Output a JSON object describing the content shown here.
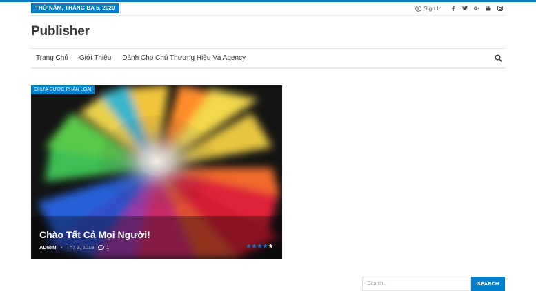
{
  "topbar": {
    "date": "THỨ NĂM, THÁNG BA 5, 2020",
    "signin_label": "Sign In",
    "socials": [
      "facebook-icon",
      "twitter-icon",
      "google-plus-icon",
      "youtube-icon",
      "instagram-icon"
    ],
    "accent": "#0080ce"
  },
  "site": {
    "logo": "Publisher"
  },
  "nav": {
    "items": [
      {
        "label": "Trang Chủ"
      },
      {
        "label": "Giới Thiệu"
      },
      {
        "label": "Dành Cho Chủ Thương Hiệu Và Agency"
      }
    ]
  },
  "post": {
    "category": "CHƯA ĐƯỢC PHÂN LOẠI",
    "title": "Chào Tất Cả Mọi Người!",
    "author": "ADMIN",
    "date": "Th7 3, 2019",
    "comments": "1",
    "rating_filled": 4,
    "rating_max": 5
  },
  "sidebar": {
    "search_placeholder": "Search...",
    "search_button": "SEARCH"
  }
}
